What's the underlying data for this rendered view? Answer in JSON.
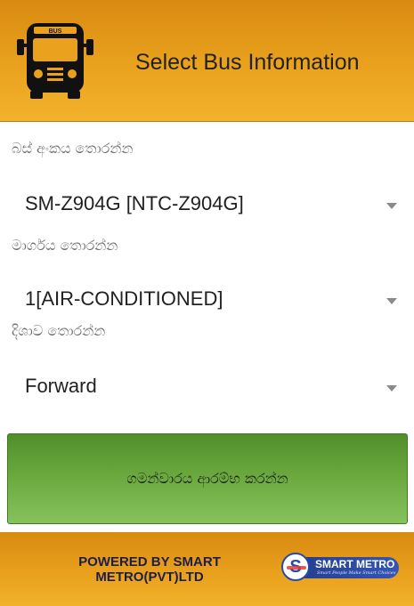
{
  "header": {
    "title": "Select Bus Information",
    "icon": "bus-icon",
    "bus_icon_text": "BUS"
  },
  "fields": [
    {
      "label": "බස් අංකය තොරන්න",
      "value": "SM-Z904G [NTC-Z904G]"
    },
    {
      "label": "මාර්ගය තොරන්න",
      "value": "1[AIR-CONDITIONED]"
    },
    {
      "label": "දිශාව තොරන්න",
      "value": "Forward"
    }
  ],
  "start_button": {
    "label": "ගමන්වාරය ආරම්භ කරන්න"
  },
  "footer": {
    "powered_by": "POWERED BY SMART METRO(PVT)LTD",
    "logo_name": "SMART METRO",
    "logo_tagline": "Smart People Make Smart Choices"
  },
  "colors": {
    "header_orange": "#eaa21e",
    "button_green": "#6aa83e",
    "logo_blue": "#2b4aa6"
  }
}
